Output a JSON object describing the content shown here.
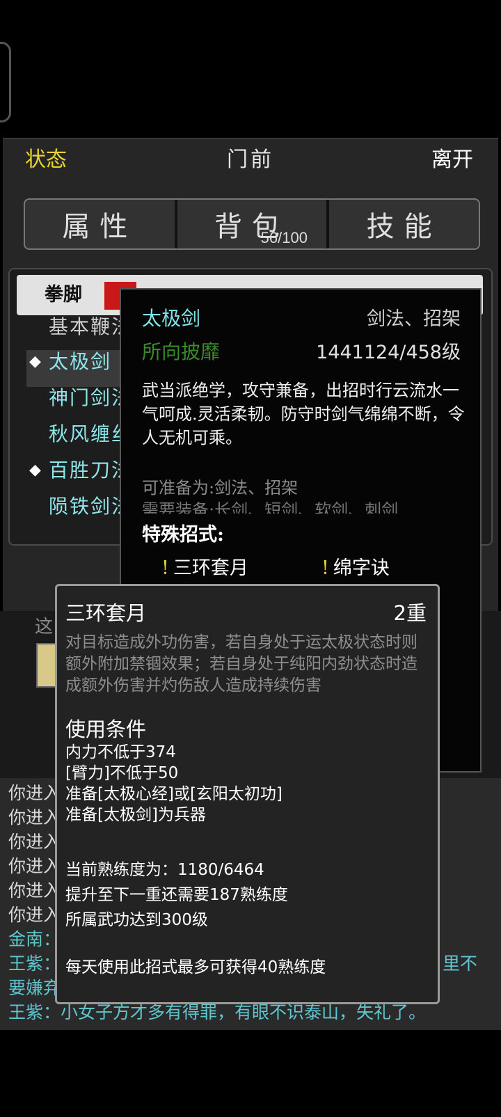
{
  "header": {
    "status": "状态",
    "location": "门前",
    "leave": "离开"
  },
  "tabs": [
    {
      "label": "属性"
    },
    {
      "label": "背包",
      "count": "56/100"
    },
    {
      "label": "技能"
    }
  ],
  "categories": {
    "active": "拳脚"
  },
  "skills": [
    {
      "label": "基本鞭法",
      "selected": false
    },
    {
      "label": "太极剑",
      "selected": true
    },
    {
      "label": "神门剑法",
      "selected": false
    },
    {
      "label": "秋风缠丝",
      "selected": false
    },
    {
      "label": "百胜刀法",
      "selected": false,
      "marked": true
    },
    {
      "label": "陨铁剑法",
      "selected": false
    }
  ],
  "skill_popup": {
    "name": "太极剑",
    "type": "剑法、招架",
    "title": "所向披靡",
    "level": "1441124/458级",
    "description": "武当派绝学，攻守兼备，出招时行云流水一气呵成.灵活柔韧。防守时剑气绵绵不断，令人无机可乘。",
    "equip_as": "可准备为:剑法、招架",
    "requires": "需要装备:长剑、短剑、软剑、刺剑",
    "special_header": "特殊招式:",
    "moves": [
      {
        "label": "三环套月"
      },
      {
        "label": "绵字诀"
      }
    ]
  },
  "move_popup": {
    "name": "三环套月",
    "rank": "2重",
    "description": "对目标造成外功伤害，若自身处于运太极状态时则额外附加禁锢效果；若自身处于纯阳内劲状态时造成额外伤害并灼伤敌人造成持续伤害",
    "conditions_header": "使用条件",
    "conditions": [
      "内力不低于374",
      "[臂力]不低于50",
      "准备[太极心经]或[玄阳太初功]",
      "准备[太极剑]为兵器"
    ],
    "proficiency": "当前熟练度为：1180/6464",
    "next_need": "提升至下一重还需要187熟练度",
    "level_req": "所属武功达到300级",
    "daily": "每天使用此招式最多可获得40熟练度"
  },
  "background": {
    "mid_text": "这",
    "chat": [
      {
        "text": "你进入",
        "color": "#d8d8d8"
      },
      {
        "text": "你进入",
        "color": "#d8d8d8"
      },
      {
        "text": "你进入",
        "color": "#d8d8d8"
      },
      {
        "text": "你进入",
        "color": "#d8d8d8"
      },
      {
        "text": "你进入",
        "color": "#d8d8d8"
      },
      {
        "text": "你进入",
        "color": "#d8d8d8"
      },
      {
        "text": "金南：",
        "color": "#5fc6cf"
      },
      {
        "text": "王紫：",
        "color": "#5fc6cf",
        "tail": "里不"
      },
      {
        "text": "要嫌弃",
        "color": "#5fc6cf"
      },
      {
        "text": "王紫：小女子方才多有得罪，有眼不识泰山，失礼了。",
        "color": "#5fc6cf"
      }
    ]
  },
  "colors": {
    "accent_yellow": "#e8d630",
    "teal": "#7fe3e8",
    "green_title": "#3a8a2a"
  }
}
